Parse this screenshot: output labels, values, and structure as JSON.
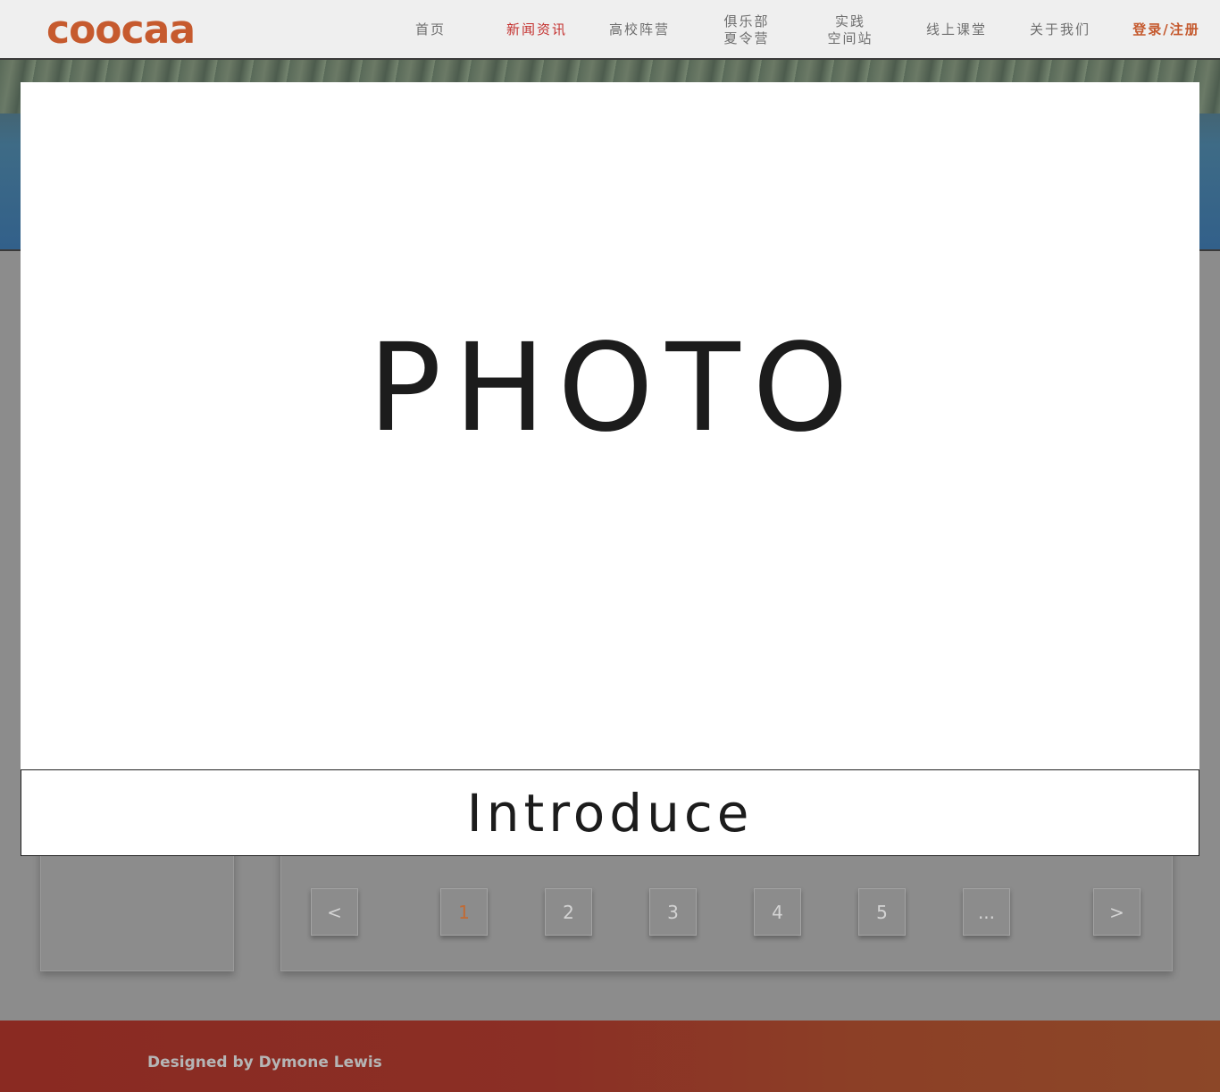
{
  "header": {
    "logo": "coocaa",
    "nav": [
      {
        "label": "首页"
      },
      {
        "label": "新闻资讯",
        "active": true
      },
      {
        "label": "高校阵营"
      },
      {
        "label": "俱乐部\n夏令营"
      },
      {
        "label": "实践\n空间站"
      },
      {
        "label": "线上课堂"
      },
      {
        "label": "关于我们"
      }
    ],
    "login": "登录/注册"
  },
  "modal": {
    "photo_label": "PHOTO",
    "intro_label": "Introduce"
  },
  "pagination": {
    "prev": "<",
    "pages": [
      "1",
      "2",
      "3",
      "4",
      "5",
      "..."
    ],
    "current": "1",
    "next": ">"
  },
  "footer": {
    "credit": "Designed by Dymone Lewis"
  },
  "colors": {
    "accent": "#c65a2e",
    "active_nav": "#c4312f",
    "overlay": "#8c8c8c",
    "footer": "#8a2a22"
  }
}
